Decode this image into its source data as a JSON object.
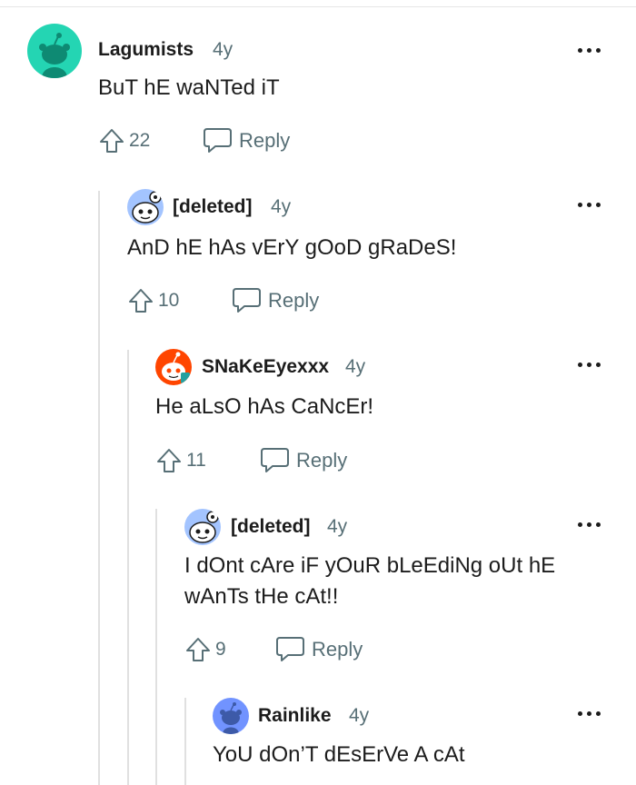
{
  "comments": [
    {
      "author": "Lagumists",
      "age": "4y",
      "body": "BuT hE waNTed iT",
      "votes": "22",
      "reply_label": "Reply",
      "avatar": "snoo-teal-avatar"
    },
    {
      "author": "[deleted]",
      "age": "4y",
      "body": "AnD hE hAs vErY gOoD gRaDeS!",
      "votes": "10",
      "reply_label": "Reply",
      "avatar": "snoo-deleted-avatar"
    },
    {
      "author": "SNaKeEyexxx",
      "age": "4y",
      "body": "He aLsO hAs CaNcEr!",
      "votes": "11",
      "reply_label": "Reply",
      "avatar": "snoo-orange-avatar"
    },
    {
      "author": "[deleted]",
      "age": "4y",
      "body": "I dOnt cAre iF yOuR bLeEdiNg oUt hE wAnTs tHe cAt!!",
      "votes": "9",
      "reply_label": "Reply",
      "avatar": "snoo-deleted-avatar"
    },
    {
      "author": "Rainlike",
      "age": "4y",
      "body": "YoU dOn’T dEsErVe A cAt",
      "avatar": "snoo-blue-avatar"
    }
  ],
  "colors": {
    "text": "#1c1c1c",
    "meta": "#576f76",
    "thread_line": "#e0e0e0",
    "teal_avatar": "#24d5b3",
    "blue_avatar": "#7193ff"
  }
}
